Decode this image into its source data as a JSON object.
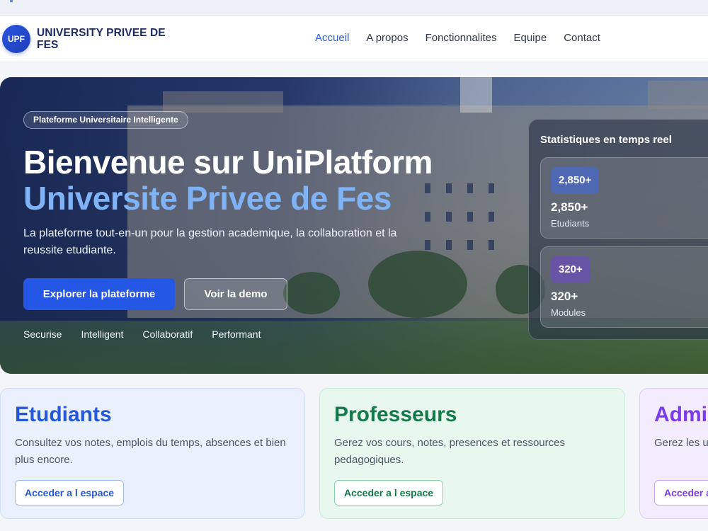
{
  "header": {
    "logo_badge": "UPF",
    "brand_name": "UNIVERSITY PRIVEE DE FES",
    "nav": [
      {
        "label": "Accueil",
        "active": true
      },
      {
        "label": "A propos",
        "active": false
      },
      {
        "label": "Fonctionnalites",
        "active": false
      },
      {
        "label": "Equipe",
        "active": false
      },
      {
        "label": "Contact",
        "active": false
      }
    ]
  },
  "hero": {
    "badge": "Plateforme Universitaire Intelligente",
    "title_line1": "Bienvenue sur UniPlatform",
    "title_line2": "Universite Privee de Fes",
    "description": "La plateforme tout-en-un pour la gestion academique, la collaboration et la reussite etudiante.",
    "primary_button": "Explorer la plateforme",
    "secondary_button": "Voir la demo",
    "features": [
      "Securise",
      "Intelligent",
      "Collaboratif",
      "Performant"
    ]
  },
  "stats": {
    "title": "Statistiques en temps reel",
    "items": [
      {
        "badge": "2,850+",
        "value": "2,850+",
        "label": "Etudiants",
        "color": "#4a68c8"
      },
      {
        "badge": "320+",
        "value": "320+",
        "label": "Modules",
        "color": "#6a4fb8"
      }
    ]
  },
  "cards": [
    {
      "title": "Etudiants",
      "description": "Consultez vos notes, emplois du temps, absences et bien plus encore.",
      "button": "Acceder a l espace",
      "accent": "#2558d6"
    },
    {
      "title": "Professeurs",
      "description": "Gerez vos cours, notes, presences et ressources pedagogiques.",
      "button": "Acceder a l espace",
      "accent": "#147a4a"
    },
    {
      "title": "Admi",
      "description": "Gerez les u parametres",
      "button": "Acceder a",
      "accent": "#7c3aed"
    }
  ],
  "colors": {
    "primary": "#2457e6",
    "brand_dark": "#1d2b64",
    "title_highlight": "#7fb3f5"
  }
}
